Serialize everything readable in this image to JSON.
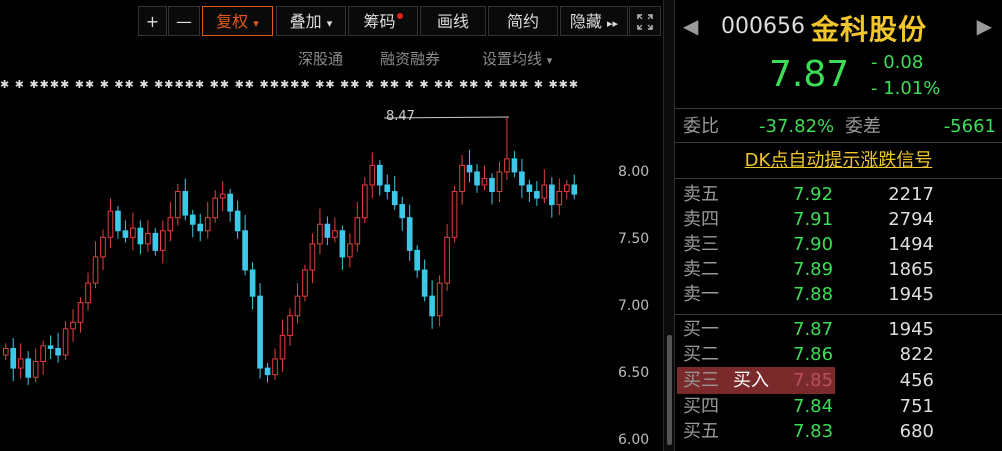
{
  "toolbar": {
    "plus": "+",
    "minus": "—",
    "fuquan": "复权",
    "fuquan_caret": "▾",
    "diejia": "叠加",
    "diejia_caret": "▾",
    "chouma": "筹码",
    "huaxian": "画线",
    "jianyue": "简约",
    "yincang": "隐藏",
    "yincang_arrows": "▸▸",
    "fullscreen_icon": "expand-icon"
  },
  "subnav": {
    "shengutong": "深股通",
    "rongzi": "融资融券",
    "junxian": "设置均线",
    "junxian_caret": "▾"
  },
  "chart_data": {
    "type": "candlestick",
    "ylim": [
      6.0,
      8.6
    ],
    "yticks": [
      "8.00",
      "7.50",
      "7.00",
      "6.50",
      "6.00"
    ],
    "annotation": "8.47",
    "max_value": 8.47,
    "up_color": "#e04040",
    "down_color": "#3ec8e8",
    "marker_row": "✱ ✱ ✱✱✱✱ ✱✱ ✱ ✱✱ ✱ ✱✱✱✱✱ ✱✱ ✱✱ ✱✱✱✱✱ ✱✱ ✱✱ ✱ ✱✱ ✱ ✱ ✱✱ ✱✱ ✱ ✱✱✱ ✱ ✱✱✱✱✱✱✱ ✱✱ ✱"
  },
  "quote": {
    "prev_arrow": "◀",
    "next_arrow": "▶",
    "code": "000656",
    "name": "金科股份",
    "price": "7.87",
    "change": "- 0.08",
    "change_pct": "- 1.01%"
  },
  "weibi": {
    "label": "委比",
    "value": "-37.82%",
    "diff_label": "委差",
    "diff_value": "-5661"
  },
  "dk_signal": "DK点自动提示涨跌信号",
  "asks": [
    {
      "label": "卖五",
      "price": "7.92",
      "vol": "2217"
    },
    {
      "label": "卖四",
      "price": "7.91",
      "vol": "2794"
    },
    {
      "label": "卖三",
      "price": "7.90",
      "vol": "1494"
    },
    {
      "label": "卖二",
      "price": "7.89",
      "vol": "1865"
    },
    {
      "label": "卖一",
      "price": "7.88",
      "vol": "1945"
    }
  ],
  "bids": [
    {
      "label": "买一",
      "price": "7.87",
      "vol": "1945"
    },
    {
      "label": "买二",
      "price": "7.86",
      "vol": "822"
    },
    {
      "label": "买三",
      "price": "7.85",
      "vol": "456"
    },
    {
      "label": "买四",
      "price": "7.84",
      "vol": "751"
    },
    {
      "label": "买五",
      "price": "7.83",
      "vol": "680"
    }
  ],
  "buy_button": "买入",
  "colors": {
    "accent": "#e25a1c",
    "up": "#3fdc58",
    "name": "#f0c62a"
  }
}
